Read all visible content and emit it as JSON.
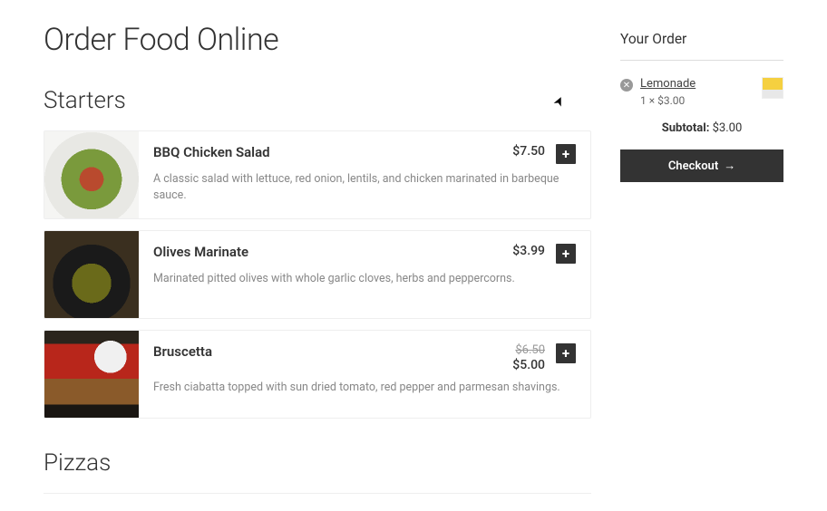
{
  "page": {
    "title": "Order Food Online"
  },
  "sections": [
    {
      "title": "Starters"
    },
    {
      "title": "Pizzas"
    }
  ],
  "items": [
    {
      "name": "BBQ Chicken Salad",
      "desc": "A classic salad with lettuce, red onion, lentils, and chicken marinated in barbeque sauce.",
      "price": "$7.50",
      "old_price": "",
      "thumb": "salad"
    },
    {
      "name": "Olives Marinate",
      "desc": "Marinated pitted olives with whole garlic cloves, herbs and peppercorns.",
      "price": "$3.99",
      "old_price": "",
      "thumb": "olives"
    },
    {
      "name": "Bruscetta",
      "desc": "Fresh ciabatta topped with sun dried tomato, red pepper and parmesan shavings.",
      "price": "$5.00",
      "old_price": "$6.50",
      "thumb": "bruscetta"
    }
  ],
  "cart": {
    "title": "Your Order",
    "lines": [
      {
        "name": "Lemonade",
        "qty": "1 × $3.00"
      }
    ],
    "subtotal_label": "Subtotal:",
    "subtotal_value": "$3.00",
    "checkout_label": "Checkout"
  },
  "glyphs": {
    "plus": "+",
    "close": "✕",
    "arrow": "→"
  }
}
